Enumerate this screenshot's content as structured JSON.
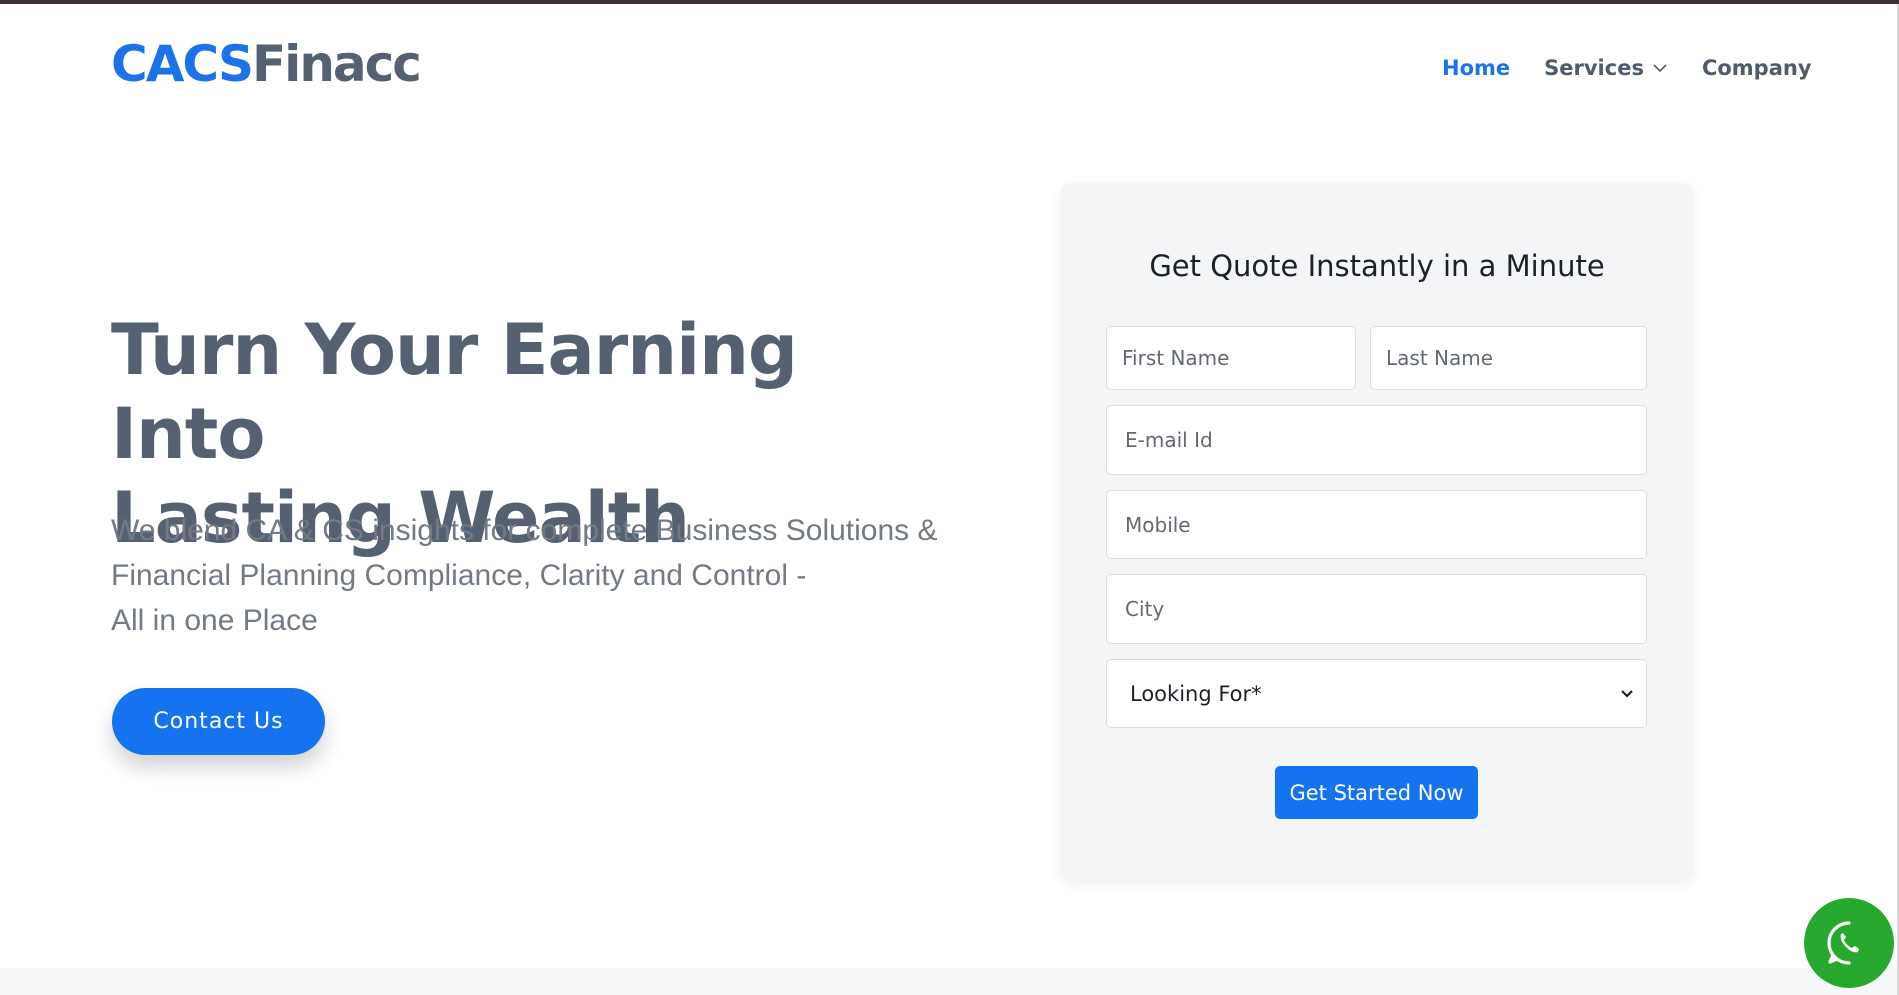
{
  "brand": {
    "part1": "CACS",
    "part2": "Finacc",
    "color_primary": "#1a73e8",
    "color_secondary": "#556171"
  },
  "nav": {
    "items": [
      {
        "label": "Home",
        "active": true
      },
      {
        "label": "Services",
        "has_dropdown": true
      },
      {
        "label": "Company"
      }
    ]
  },
  "hero": {
    "title_line1": "Turn Your Earning Into",
    "title_line2": "Lasting Wealth",
    "subtitle_line1": "We blend CA & CS insights for complete Business Solutions &",
    "subtitle_line2": "Financial Planning Compliance, Clarity and Control -",
    "subtitle_line3": "All in one Place",
    "cta_label": "Contact Us"
  },
  "form": {
    "title": "Get Quote Instantly in a Minute",
    "first_name_placeholder": "First Name",
    "last_name_placeholder": "Last Name",
    "email_placeholder": "E-mail Id",
    "mobile_placeholder": "Mobile",
    "city_placeholder": "City",
    "looking_for": "Looking For*",
    "submit_label": "Get Started Now"
  },
  "icons": {
    "services_dropdown": "chevron-down-icon",
    "select_dropdown": "chevron-down-icon",
    "chat": "whatsapp-icon"
  },
  "colors": {
    "accent": "#1573f0",
    "whatsapp": "#27a82e",
    "card_bg": "#f4f5f7"
  }
}
